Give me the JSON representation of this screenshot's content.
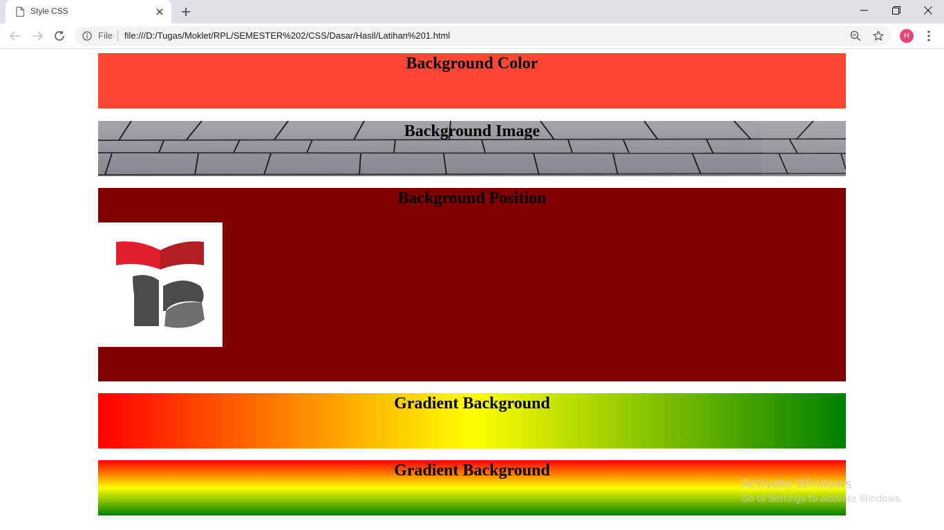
{
  "browser": {
    "tab_title": "Style CSS",
    "omnibox_scheme_label": "File",
    "url": "file:///D:/Tugas/Moklet/RPL/SEMESTER%202/CSS/Dasar/Hasil/Latihan%201.html",
    "avatar_letter": "H"
  },
  "page": {
    "sections": [
      {
        "heading": "Background Color",
        "color": "#ff4733"
      },
      {
        "heading": "Background Image"
      },
      {
        "heading": "Background Position",
        "color": "#800000"
      },
      {
        "heading": "Gradient Background",
        "gradient_direction": "horizontal",
        "colors": [
          "#ff0000",
          "#ffff00",
          "#008000"
        ]
      },
      {
        "heading": "Gradient Background",
        "gradient_direction": "vertical",
        "colors": [
          "#ff0000",
          "#ffff00",
          "#008000"
        ]
      }
    ]
  },
  "watermark": {
    "line1": "Activate Windows",
    "line2": "Go to Settings to activate Windows."
  },
  "icons": [
    "page-icon",
    "close-icon",
    "plus-icon",
    "minimize-icon",
    "restore-icon",
    "back-arrow-icon",
    "forward-arrow-icon",
    "reload-icon",
    "info-icon",
    "zoom-icon",
    "star-icon",
    "menu-icon"
  ]
}
